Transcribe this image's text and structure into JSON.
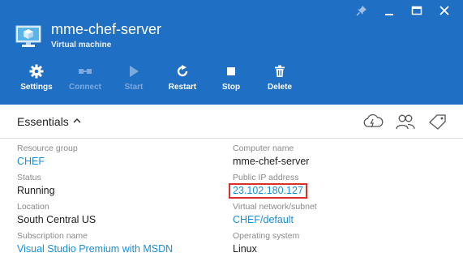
{
  "header": {
    "title": "mme-chef-server",
    "subtitle": "Virtual machine"
  },
  "toolbar": [
    {
      "label": "Settings",
      "icon": "gear-icon",
      "enabled": true
    },
    {
      "label": "Connect",
      "icon": "connect-icon",
      "enabled": false
    },
    {
      "label": "Start",
      "icon": "play-icon",
      "enabled": false
    },
    {
      "label": "Restart",
      "icon": "restart-icon",
      "enabled": true
    },
    {
      "label": "Stop",
      "icon": "stop-icon",
      "enabled": true
    },
    {
      "label": "Delete",
      "icon": "trash-icon",
      "enabled": true
    }
  ],
  "essentials": {
    "title": "Essentials",
    "left": [
      {
        "label": "Resource group",
        "value": "CHEF",
        "link": true
      },
      {
        "label": "Status",
        "value": "Running",
        "link": false
      },
      {
        "label": "Location",
        "value": "South Central US",
        "link": false
      },
      {
        "label": "Subscription name",
        "value": "Visual Studio Premium with MSDN",
        "link": true
      }
    ],
    "right": [
      {
        "label": "Computer name",
        "value": "mme-chef-server",
        "link": false
      },
      {
        "label": "Public IP address",
        "value": "23.102.180.127",
        "link": true,
        "highlighted": true
      },
      {
        "label": "Virtual network/subnet",
        "value": "CHEF/default",
        "link": true
      },
      {
        "label": "Operating system",
        "value": "Linux",
        "link": false
      }
    ]
  },
  "colors": {
    "header_bg": "#1f6fc4",
    "link": "#1a8fd6",
    "highlight_border": "#d9302c"
  }
}
